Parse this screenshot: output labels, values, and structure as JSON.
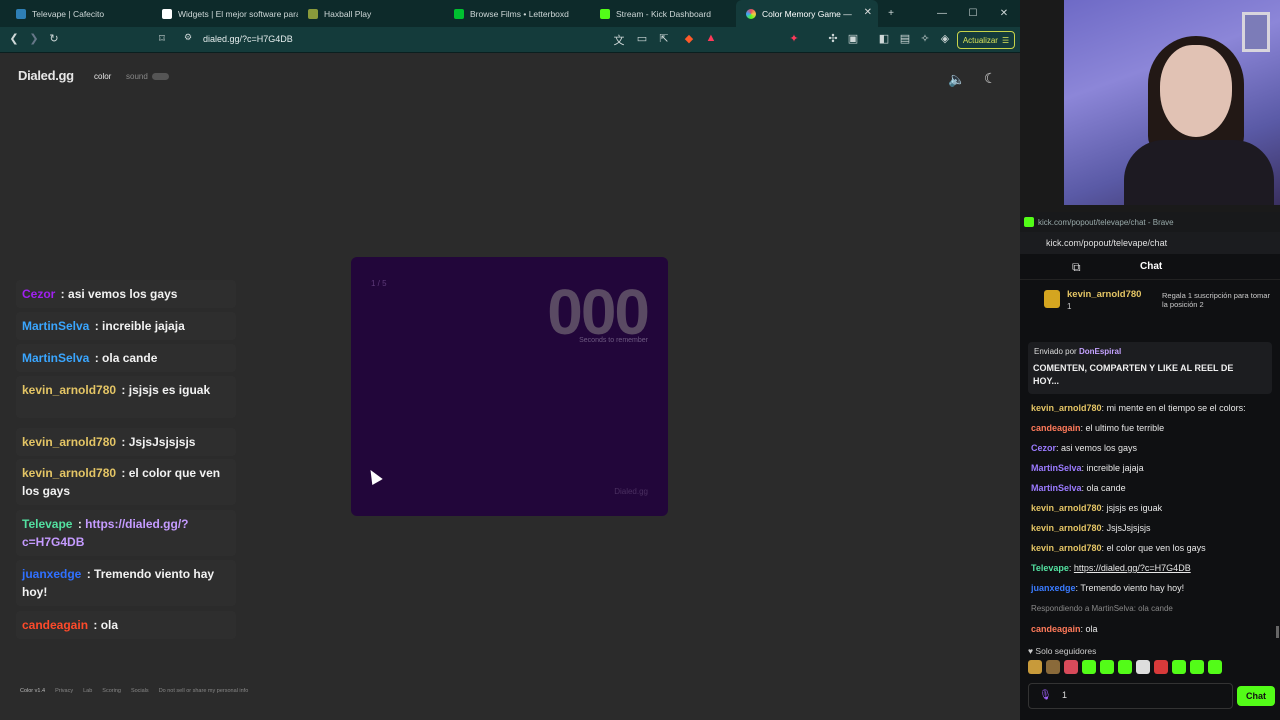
{
  "tabs": [
    {
      "label": "Televape | Cafecito",
      "color": "#2e7fb5"
    },
    {
      "label": "Widgets | El mejor software para",
      "color": "#ffffff"
    },
    {
      "label": "Haxball Play",
      "color": "#8a9a3b"
    },
    {
      "label": "Browse Films • Letterboxd",
      "color": "#00c030"
    },
    {
      "label": "Stream - Kick Dashboard",
      "color": "#53fc18"
    },
    {
      "label": "Color Memory Game —",
      "color": "#e84a5f",
      "active": true
    }
  ],
  "address": {
    "url": "dialed.gg/?c=H7G4DB",
    "update_label": "Actualizar"
  },
  "site": {
    "logo": "Dialed.gg",
    "nav_color": "color",
    "nav_sound": "sound",
    "game": {
      "counter": "1 / 5",
      "timer": "000",
      "timer_caption": "Seconds to remember",
      "watermark": "Dialed.gg"
    },
    "footer": [
      "Color v1.4",
      "Privacy",
      "Lab",
      "Scoring",
      "Socials",
      "Do not sell or share my personal info"
    ]
  },
  "overlay_chat": [
    {
      "user": "Cezor",
      "color": "#a020f0",
      "text": "asi vemos los gays"
    },
    {
      "user": "MartinSelva",
      "color": "#3aa6ff",
      "text": "increible jajaja"
    },
    {
      "user": "MartinSelva",
      "color": "#3aa6ff",
      "text": "ola cande"
    },
    {
      "user": "kevin_arnold780",
      "color": "#e4c565",
      "text": "jsjsjs es iguak"
    },
    {
      "user": "kevin_arnold780",
      "color": "#e4c565",
      "text": "JsjsJsjsjsjs"
    },
    {
      "user": "kevin_arnold780",
      "color": "#e4c565",
      "text": "el color que ven los gays"
    },
    {
      "user": "Televape",
      "color": "#53e0a0",
      "text": "https://dialed.gg/?c=H7G4DB",
      "link": true
    },
    {
      "user": "juanxedge",
      "color": "#3070ff",
      "text": "Tremendo viento hay hoy!"
    },
    {
      "user": "candeagain",
      "color": "#ff4a2a",
      "text": "ola"
    }
  ],
  "kick": {
    "window_title": "kick.com/popout/televape/chat - Brave",
    "url": "kick.com/popout/televape/chat",
    "header": "Chat",
    "gift": {
      "user": "kevin_arnold780",
      "count": "1",
      "text": "Regala 1 suscripción para tomar la posición 2"
    },
    "pinned": {
      "by_label": "Enviado por",
      "by_user": "DonEspiral",
      "text": "COMENTEN, COMPARTEN Y LIKE AL REEL DE HOY..."
    },
    "messages": [
      {
        "user": "kevin_arnold780",
        "color": "#e4c565",
        "text": "mi mente en el tiempo se el colors:"
      },
      {
        "user": "candeagain",
        "color": "#ff7a5a",
        "text": "el ultimo fue terrible"
      },
      {
        "user": "Cezor",
        "color": "#9b7bff",
        "text": "asi vemos los gays"
      },
      {
        "user": "MartinSelva",
        "color": "#9b7bff",
        "text": "increible jajaja"
      },
      {
        "user": "MartinSelva",
        "color": "#9b7bff",
        "text": "ola cande"
      },
      {
        "user": "kevin_arnold780",
        "color": "#e4c565",
        "text": "jsjsjs es iguak"
      },
      {
        "user": "kevin_arnold780",
        "color": "#e4c565",
        "text": "JsjsJsjsjsjs"
      },
      {
        "user": "kevin_arnold780",
        "color": "#e4c565",
        "text": "el color que ven los gays"
      },
      {
        "user": "Televape",
        "color": "#53e0a0",
        "text": "https://dialed.gg/?c=H7G4DB"
      },
      {
        "user": "juanxedge",
        "color": "#3a7bff",
        "text": "Tremendo viento hay hoy!"
      },
      {
        "user": "Respondiendo a MartinSelva: ola cande",
        "color": "#888888",
        "text": ""
      },
      {
        "user": "candeagain",
        "color": "#ff7a5a",
        "text": "ola"
      }
    ],
    "followers_only": "Solo seguidores",
    "input_count": "1",
    "chat_button": "Chat"
  }
}
